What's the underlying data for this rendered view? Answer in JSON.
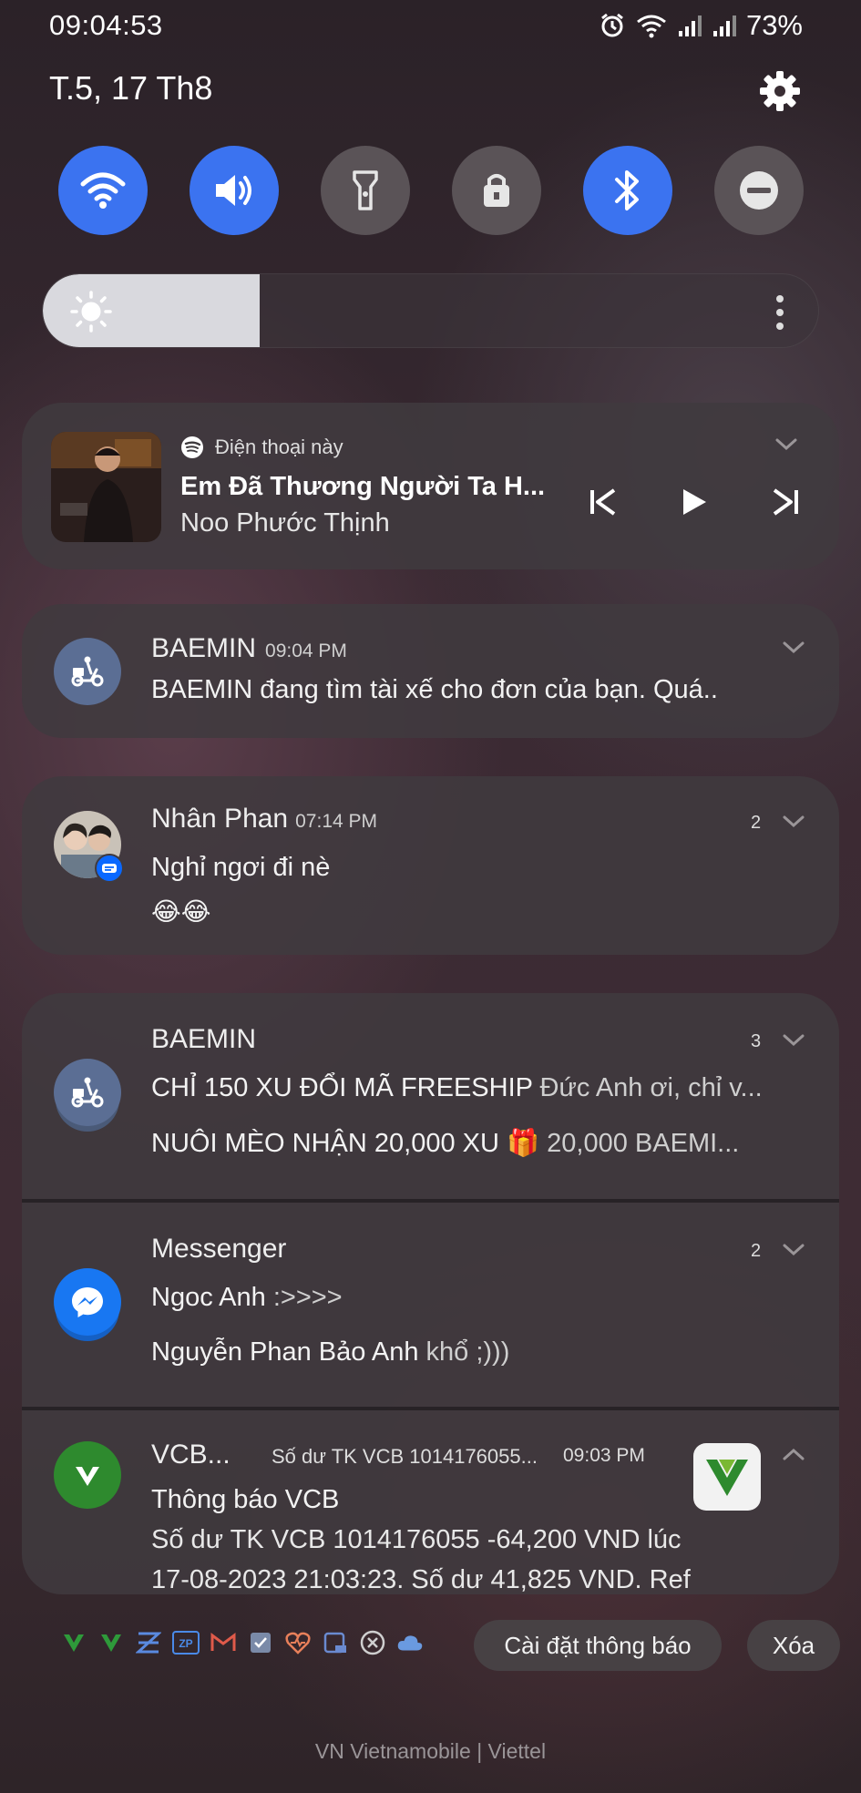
{
  "status": {
    "time": "09:04:53",
    "battery": "73%"
  },
  "header": {
    "date": "T.5, 17 Th8"
  },
  "quick_settings": [
    {
      "icon": "wifi-icon",
      "state": "on"
    },
    {
      "icon": "volume-icon",
      "state": "on"
    },
    {
      "icon": "flashlight-icon",
      "state": "off"
    },
    {
      "icon": "lock-rotation-icon",
      "state": "off"
    },
    {
      "icon": "bluetooth-icon",
      "state": "on"
    },
    {
      "icon": "do-not-disturb-icon",
      "state": "off"
    }
  ],
  "brightness": {
    "level": 0.28
  },
  "media": {
    "source": "Điện thoại này",
    "title": "Em Đã Thương Người Ta H...",
    "artist": "Noo Phước Thịnh"
  },
  "notifications": {
    "baemin_driver": {
      "app": "BAEMIN",
      "time": "09:04 PM",
      "text": "BAEMIN đang tìm tài xế cho đơn của bạn. Quá.."
    },
    "nhan_phan": {
      "name": "Nhân Phan",
      "time": "07:14 PM",
      "count": "2",
      "line1": "Nghỉ ngơi đi nè",
      "line2": "😂😂"
    },
    "baemin_promo": {
      "app": "BAEMIN",
      "count": "3",
      "m1_title": "CHỈ 150 XU ĐỔI MÃ FREESHIP",
      "m1_text": " Đức Anh ơi, chỉ v...",
      "m2_title": "NUÔI MÈO NHẬN 20,000 XU",
      "m2_text": " 🎁 20,000 BAEMI..."
    },
    "messenger": {
      "app": "Messenger",
      "count": "2",
      "m1_sender": "Ngoc Anh",
      "m1_text": " :>>>>",
      "m2_sender": "Nguyễn Phan Bảo Anh",
      "m2_text": " khổ ;)))"
    },
    "vcb": {
      "app": "VCB...",
      "subtitle": "Số dư TK VCB 1014176055...",
      "time": "09:03 PM",
      "title": "Thông báo VCB",
      "body1": "Số dư TK VCB 1014176055 -64,200 VND lúc",
      "body2": "17-08-2023 21:03:23. Số dư 41,825 VND. Ref"
    }
  },
  "actions": {
    "settings": "Cài đặt thông báo",
    "clear": "Xóa"
  },
  "carrier": "VN Vietnamobile | Viettel",
  "colors": {
    "accent": "#3b73f0",
    "vcb_green": "#2e8a2e",
    "baemin": "#5b6e94",
    "messenger": "#1877f2"
  }
}
